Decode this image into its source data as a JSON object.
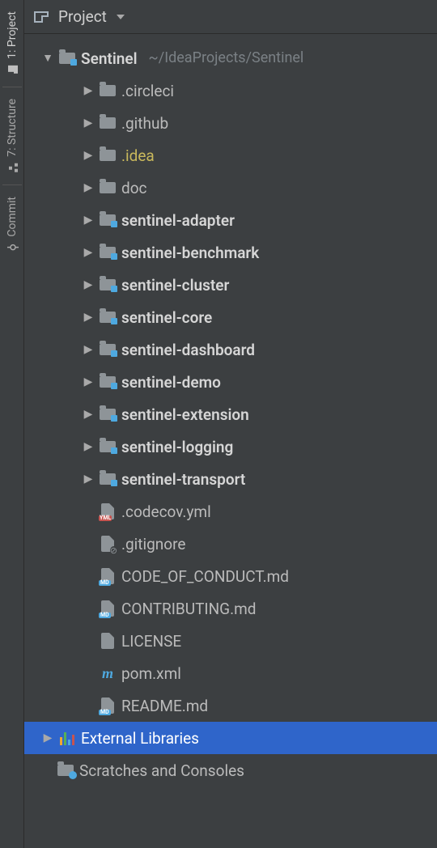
{
  "header": {
    "view_label": "Project"
  },
  "sidebar_tabs": {
    "project": "1: Project",
    "structure": "7: Structure",
    "commit": "Commit"
  },
  "tree": {
    "root": {
      "name": "Sentinel",
      "path": "~/IdeaProjects/Sentinel"
    },
    "children": [
      {
        "name": ".circleci",
        "type": "folder"
      },
      {
        "name": ".github",
        "type": "folder"
      },
      {
        "name": ".idea",
        "type": "folder",
        "style": "idea"
      },
      {
        "name": "doc",
        "type": "folder"
      },
      {
        "name": "sentinel-adapter",
        "type": "module"
      },
      {
        "name": "sentinel-benchmark",
        "type": "module"
      },
      {
        "name": "sentinel-cluster",
        "type": "module"
      },
      {
        "name": "sentinel-core",
        "type": "module"
      },
      {
        "name": "sentinel-dashboard",
        "type": "module"
      },
      {
        "name": "sentinel-demo",
        "type": "module"
      },
      {
        "name": "sentinel-extension",
        "type": "module"
      },
      {
        "name": "sentinel-logging",
        "type": "module"
      },
      {
        "name": "sentinel-transport",
        "type": "module"
      },
      {
        "name": ".codecov.yml",
        "type": "file",
        "icon": "yml"
      },
      {
        "name": ".gitignore",
        "type": "file",
        "icon": "ign"
      },
      {
        "name": "CODE_OF_CONDUCT.md",
        "type": "file",
        "icon": "md"
      },
      {
        "name": "CONTRIBUTING.md",
        "type": "file",
        "icon": "md"
      },
      {
        "name": "LICENSE",
        "type": "file",
        "icon": "txt"
      },
      {
        "name": "pom.xml",
        "type": "file",
        "icon": "pom"
      },
      {
        "name": "README.md",
        "type": "file",
        "icon": "md"
      }
    ],
    "external_libraries": "External Libraries",
    "scratches": "Scratches and Consoles"
  }
}
